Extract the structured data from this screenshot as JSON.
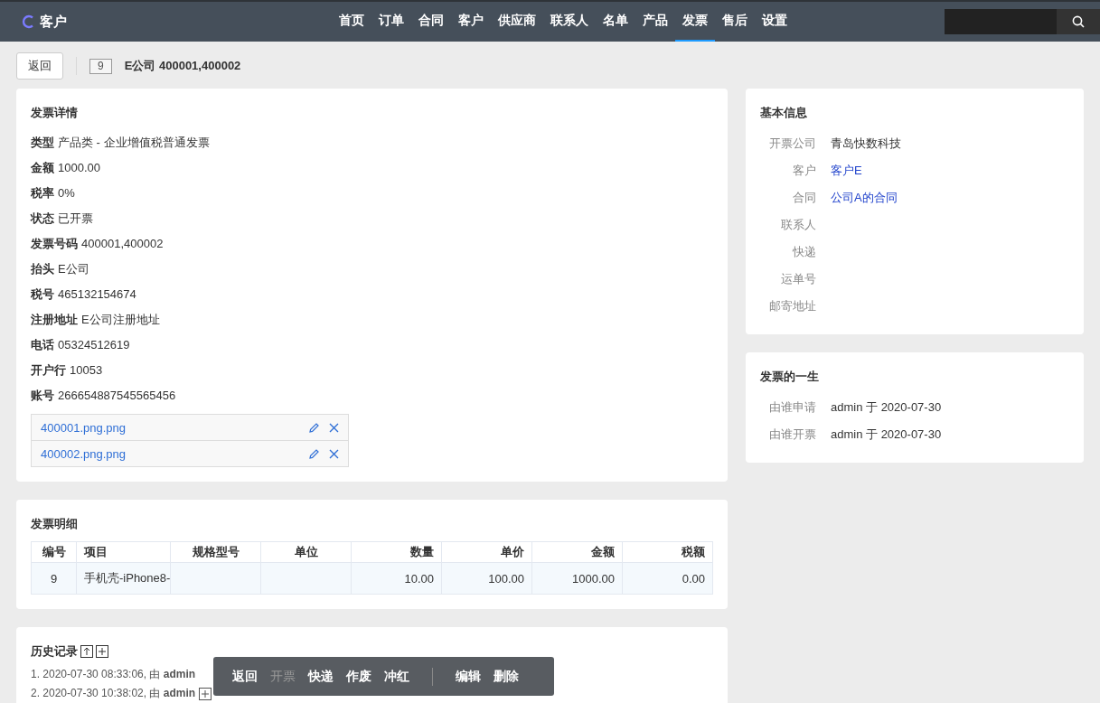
{
  "nav": {
    "logo": "客户",
    "items": [
      {
        "label": "首页",
        "selected": false
      },
      {
        "label": "订单",
        "selected": false
      },
      {
        "label": "合同",
        "selected": false
      },
      {
        "label": "客户",
        "selected": false
      },
      {
        "label": "供应商",
        "selected": false
      },
      {
        "label": "联系人",
        "selected": false
      },
      {
        "label": "名单",
        "selected": false
      },
      {
        "label": "产品",
        "selected": false
      },
      {
        "label": "发票",
        "selected": true
      },
      {
        "label": "售后",
        "selected": false
      },
      {
        "label": "设置",
        "selected": false
      }
    ]
  },
  "header": {
    "back": "返回",
    "badge": "9",
    "title": "E公司 400001,400002"
  },
  "details": {
    "title": "发票详情",
    "fields": [
      {
        "label": "类型",
        "value": "产品类 - 企业增值税普通发票"
      },
      {
        "label": "金额",
        "value": "1000.00"
      },
      {
        "label": "税率",
        "value": "0%"
      },
      {
        "label": "状态",
        "value": "已开票"
      },
      {
        "label": "发票号码",
        "value": "400001,400002"
      },
      {
        "label": "抬头",
        "value": "E公司"
      },
      {
        "label": "税号",
        "value": "465132154674"
      },
      {
        "label": "注册地址",
        "value": "E公司注册地址"
      },
      {
        "label": "电话",
        "value": "05324512619"
      },
      {
        "label": "开户行",
        "value": "10053"
      },
      {
        "label": "账号",
        "value": "266654887545565456"
      }
    ],
    "files": [
      "400001.png.png",
      "400002.png.png"
    ]
  },
  "items": {
    "title": "发票明细",
    "columns": [
      "编号",
      "项目",
      "规格型号",
      "单位",
      "数量",
      "单价",
      "金额",
      "税额"
    ],
    "rows": [
      [
        "9",
        "手机壳-iPhone8-",
        "",
        "",
        "10.00",
        "100.00",
        "1000.00",
        "0.00"
      ]
    ]
  },
  "history": {
    "title": "历史记录",
    "entries": [
      {
        "text": "1. 2020-07-30 08:33:06, 由 **admin**",
        "expandable": false
      },
      {
        "text": "2. 2020-07-30 10:38:02, 由 **admin**",
        "expandable": true
      }
    ]
  },
  "basic": {
    "title": "基本信息",
    "fields": [
      {
        "label": "开票公司",
        "value": "青岛快数科技",
        "link": false
      },
      {
        "label": "客户",
        "value": "客户E",
        "link": true
      },
      {
        "label": "合同",
        "value": "公司A的合同",
        "link": true
      },
      {
        "label": "联系人"
      },
      {
        "label": "快递"
      },
      {
        "label": "运单号"
      },
      {
        "label": "邮寄地址"
      }
    ]
  },
  "life": {
    "title": "发票的一生",
    "fields": [
      {
        "label": "由谁申请",
        "value": "admin 于 2020-07-30"
      },
      {
        "label": "由谁开票",
        "value": "admin 于 2020-07-30"
      }
    ]
  },
  "actions": [
    {
      "label": "返回",
      "disabled": false
    },
    {
      "label": "开票",
      "disabled": true
    },
    {
      "label": "快递",
      "disabled": false
    },
    {
      "label": "作废",
      "disabled": false
    },
    {
      "label": "冲红",
      "disabled": false
    },
    {
      "kind": "divider"
    },
    {
      "label": "编辑",
      "disabled": false
    },
    {
      "label": "删除",
      "disabled": false
    }
  ]
}
